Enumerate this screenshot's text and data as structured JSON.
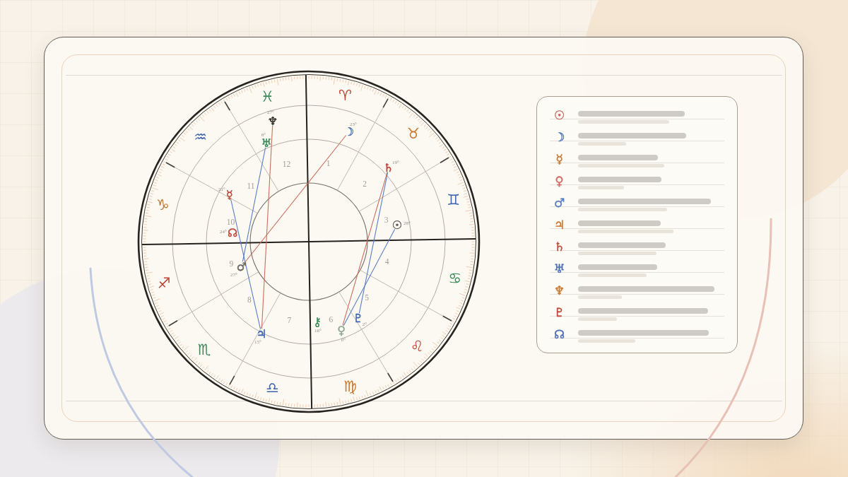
{
  "chart": {
    "signs": [
      {
        "glyph": "♓",
        "color": "#3b8a5a"
      },
      {
        "glyph": "♈",
        "color": "#c0473a"
      },
      {
        "glyph": "♉",
        "color": "#c8772e"
      },
      {
        "glyph": "♊",
        "color": "#3f64b0"
      },
      {
        "glyph": "♋",
        "color": "#3b8a5a"
      },
      {
        "glyph": "♌",
        "color": "#c0473a"
      },
      {
        "glyph": "♍",
        "color": "#c8772e"
      },
      {
        "glyph": "♎",
        "color": "#3f64b0"
      },
      {
        "glyph": "♏",
        "color": "#3b8a5a"
      },
      {
        "glyph": "♐",
        "color": "#c0473a"
      },
      {
        "glyph": "♑",
        "color": "#c8772e"
      },
      {
        "glyph": "♒",
        "color": "#3f64b0"
      }
    ],
    "houses": [
      "1",
      "2",
      "3",
      "4",
      "5",
      "6",
      "7",
      "8",
      "9",
      "10",
      "11",
      "12"
    ],
    "planets": [
      {
        "glyph": "♆",
        "degree": "27°",
        "color": "#2f2b27"
      },
      {
        "glyph": "☽",
        "degree": "23°",
        "color": "#4a6fb5"
      },
      {
        "glyph": "♅",
        "degree": "8°",
        "color": "#3b8a5a"
      },
      {
        "glyph": "♄",
        "degree": "19°",
        "color": "#c0473a"
      },
      {
        "glyph": "☿",
        "degree": "21°",
        "color": "#c0473a"
      },
      {
        "glyph": "☉",
        "degree": "28°",
        "color": "#5a5550"
      },
      {
        "glyph": "☊",
        "degree": "24°",
        "color": "#c0473a"
      },
      {
        "glyph": "♂",
        "degree": "27°",
        "color": "#6b6660"
      },
      {
        "glyph": "♇",
        "degree": "2°",
        "color": "#3f64b0"
      },
      {
        "glyph": "⚷",
        "degree": "16°",
        "color": "#3b8a5a"
      },
      {
        "glyph": "♀",
        "degree": "0°",
        "color": "#8fa894"
      },
      {
        "glyph": "♃",
        "degree": "15°",
        "color": "#3f64b0"
      }
    ],
    "aspects": [
      {
        "color": "#5b7fc4"
      },
      {
        "color": "#5b7fc4"
      },
      {
        "color": "#c8705e"
      },
      {
        "color": "#c8705e"
      },
      {
        "color": "#c8705e"
      },
      {
        "color": "#5b7fc4"
      },
      {
        "color": "#5b7fc4"
      }
    ]
  },
  "legend": {
    "items": [
      {
        "glyph": "☉",
        "color": "#c8645a"
      },
      {
        "glyph": "☽",
        "color": "#4a6fb5"
      },
      {
        "glyph": "☿",
        "color": "#c8772e"
      },
      {
        "glyph": "♀",
        "color": "#cf6e66"
      },
      {
        "glyph": "♂",
        "color": "#5b7fc4"
      },
      {
        "glyph": "♃",
        "color": "#c8772e"
      },
      {
        "glyph": "♄",
        "color": "#c0473a"
      },
      {
        "glyph": "♅",
        "color": "#4a6fb5"
      },
      {
        "glyph": "♆",
        "color": "#c8772e"
      },
      {
        "glyph": "♇",
        "color": "#c0473a"
      },
      {
        "glyph": "☊",
        "color": "#4a6fb5"
      }
    ]
  }
}
